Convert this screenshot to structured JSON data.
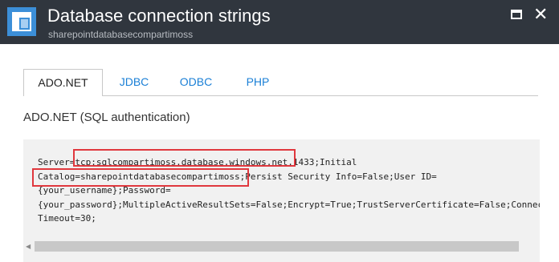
{
  "header": {
    "title": "Database connection strings",
    "subtitle": "sharepointdatabasecompartimoss",
    "app_icon": "database-blade-icon",
    "maximize_icon": "maximize-icon",
    "close_icon": "close-icon",
    "close_glyph": "✕",
    "background": "#30363e"
  },
  "tabs": [
    {
      "label": "ADO.NET",
      "active": true
    },
    {
      "label": "JDBC",
      "active": false
    },
    {
      "label": "ODBC",
      "active": false
    },
    {
      "label": "PHP",
      "active": false
    }
  ],
  "section": {
    "label": "ADO.NET (SQL authentication)"
  },
  "connection_string": {
    "lines": [
      "Server=tcp:sqlcompartimoss.database.windows.net,1433;Initial",
      "Catalog=sharepointdatabasecompartimoss;Persist Security Info=False;User ID=",
      "{your_username};Password=",
      "{your_password};MultipleActiveResultSets=False;Encrypt=True;TrustServerCertificate=False;Connection",
      "Timeout=30;"
    ],
    "highlight_color": "#e0383e"
  },
  "scrollbar": {
    "left_arrow": "◀"
  },
  "colors": {
    "accent": "#1a7fd6",
    "icon_blue": "#3c8fd8",
    "code_background": "#f1f1f1"
  }
}
